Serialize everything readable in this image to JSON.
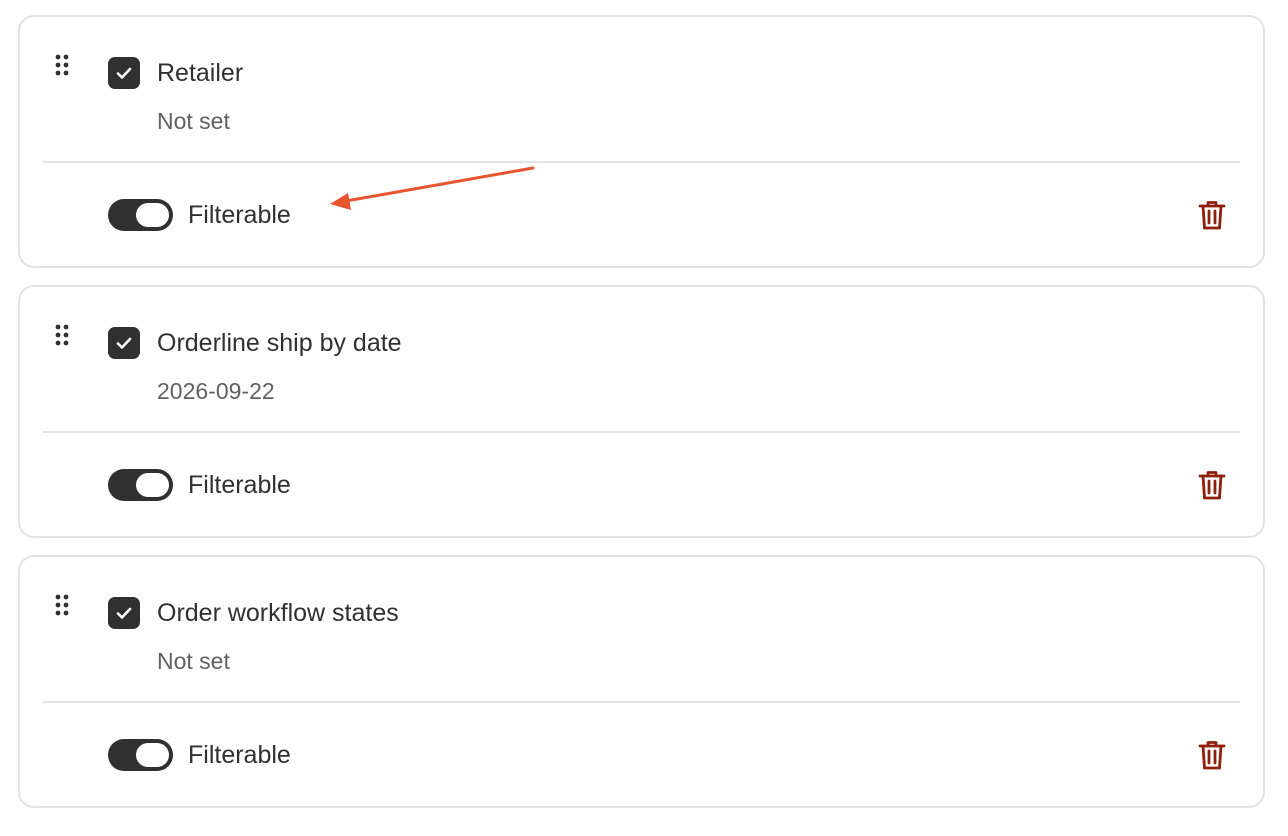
{
  "fields": [
    {
      "label": "Retailer",
      "value": "Not set",
      "checked": true,
      "toggle_label": "Filterable",
      "filterable": true
    },
    {
      "label": "Orderline ship by date",
      "value": "2026-09-22",
      "checked": true,
      "toggle_label": "Filterable",
      "filterable": true
    },
    {
      "label": "Order workflow states",
      "value": "Not set",
      "checked": true,
      "toggle_label": "Filterable",
      "filterable": true
    }
  ],
  "icons": {
    "drag": "drag-handle-icon",
    "check": "checkmark-icon",
    "delete": "trash-icon"
  },
  "colors": {
    "checkbox": "#303030",
    "toggle_on": "#303030",
    "delete": "#8e1f0b",
    "annotation_arrow": "#e8552f",
    "border": "#e3e3e3"
  }
}
